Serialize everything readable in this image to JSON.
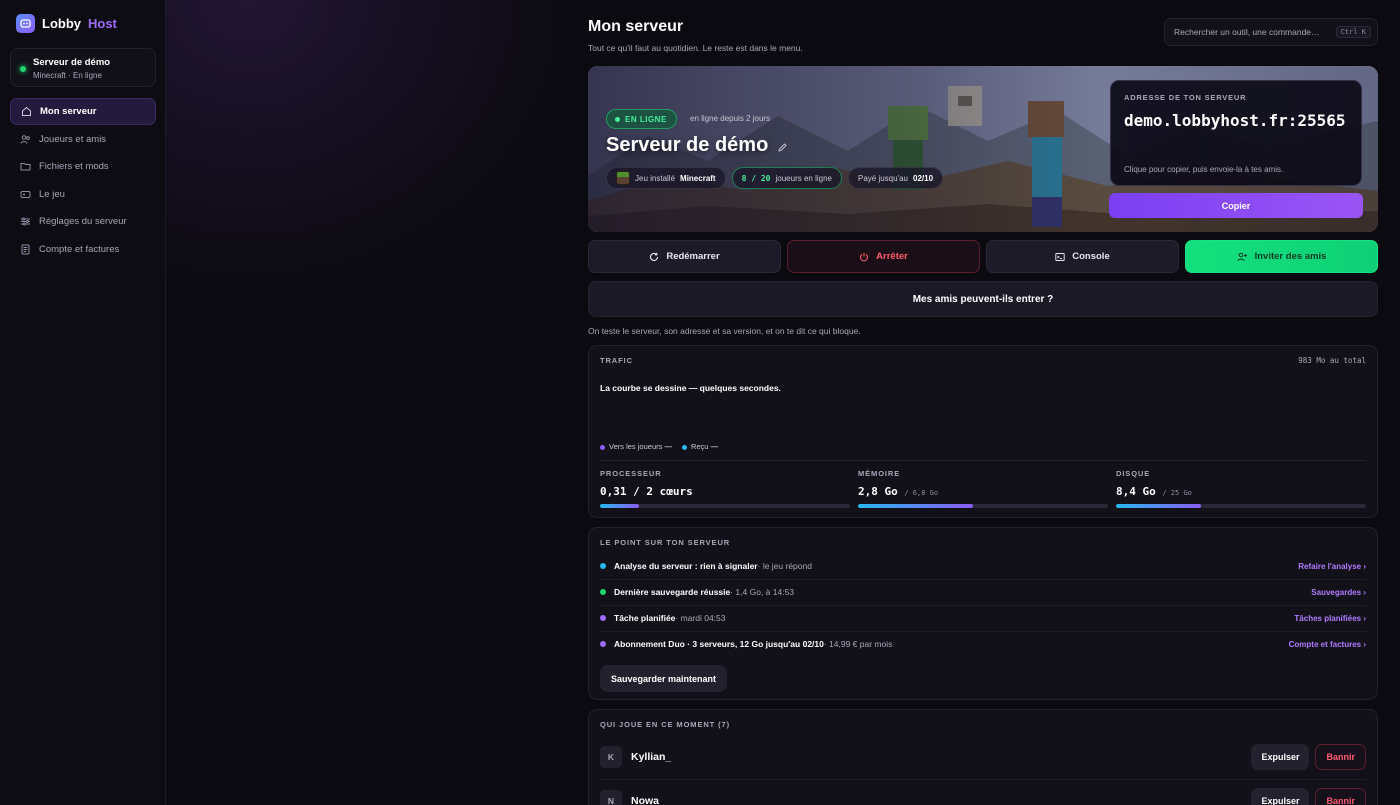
{
  "brand": {
    "part1": "Lobby",
    "part2": "Host"
  },
  "sidebar": {
    "server": {
      "name": "Serveur de démo",
      "sub": "Minecraft · En ligne"
    },
    "items": [
      {
        "label": "Mon serveur",
        "icon": "home-icon",
        "active": true
      },
      {
        "label": "Joueurs et amis",
        "icon": "users-icon"
      },
      {
        "label": "Fichiers et mods",
        "icon": "folder-icon"
      },
      {
        "label": "Le jeu",
        "icon": "gamepad-icon"
      },
      {
        "label": "Réglages du serveur",
        "icon": "sliders-icon"
      },
      {
        "label": "Compte et factures",
        "icon": "receipt-icon"
      }
    ]
  },
  "header": {
    "title": "Mon serveur",
    "subtitle": "Tout ce qu'il faut au quotidien. Le reste est dans le menu.",
    "search_placeholder": "Rechercher un outil, une commande…",
    "search_shortcut": "Ctrl K"
  },
  "hero": {
    "status": "EN LIGNE",
    "since": "en ligne depuis 2 jours",
    "name": "Serveur de démo",
    "game_label": "Jeu installé",
    "game": "Minecraft",
    "players": "8 / 20",
    "players_label": "joueurs en ligne",
    "paid_label": "Payé jusqu'au",
    "paid_until": "02/10",
    "address_label": "ADRESSE DE TON SERVEUR",
    "address": "demo.lobbyhost.fr:25565",
    "address_hint": "Clique pour copier, puis envoie-la à tes amis.",
    "copy": "Copier"
  },
  "actions": {
    "restart": "Redémarrer",
    "stop": "Arrêter",
    "console": "Console",
    "invite": "Inviter des amis"
  },
  "friends_check": {
    "label": "Mes amis peuvent-ils entrer ?",
    "note": "On teste le serveur, son adresse et sa version, et on te dit ce qui bloque."
  },
  "traffic": {
    "label": "TRAFIC",
    "total": "983 Mo au total",
    "message": "La courbe se dessine — quelques secondes.",
    "legend_out": "Vers les joueurs",
    "legend_out_value": "—",
    "legend_in": "Reçu",
    "legend_in_value": "—",
    "colors": {
      "out": "#8b5cf6",
      "in": "#27b8f0"
    }
  },
  "metrics": [
    {
      "label": "PROCESSEUR",
      "value": "0,31 / 2 cœurs",
      "of": "",
      "percent": 15.5
    },
    {
      "label": "MÉMOIRE",
      "value": "2,8 Go",
      "of": "/ 6,8 Go",
      "percent": 46
    },
    {
      "label": "DISQUE",
      "value": "8,4 Go",
      "of": "/ 25 Go",
      "percent": 34
    }
  ],
  "status": {
    "label": "LE POINT SUR TON SERVEUR",
    "rows": [
      {
        "title": "Analyse du serveur : rien à signaler",
        "detail": " · le jeu répond",
        "link": "Refaire l'analyse ›",
        "color": "#27b8f0"
      },
      {
        "title": "Dernière sauvegarde réussie",
        "detail": " · 1,4 Go, à 14:53",
        "link": "Sauvegardes ›",
        "color": "#22d56f"
      },
      {
        "title": "Tâche planifiée",
        "detail": " · mardi 04:53",
        "link": "Tâches planifiées ›",
        "color": "#a06cff"
      },
      {
        "title": "Abonnement Duo · 3 serveurs, 12 Go jusqu'au 02/10",
        "detail": " · 14,99 € par mois",
        "link": "Compte et factures ›",
        "color": "#a06cff"
      }
    ],
    "save_now": "Sauvegarder maintenant"
  },
  "players": {
    "label": "QUI JOUE EN CE MOMENT (7)",
    "list": [
      {
        "initial": "K",
        "name": "Kyllian_"
      },
      {
        "initial": "N",
        "name": "Nowa"
      }
    ],
    "kick": "Expulser",
    "ban": "Bannir"
  }
}
